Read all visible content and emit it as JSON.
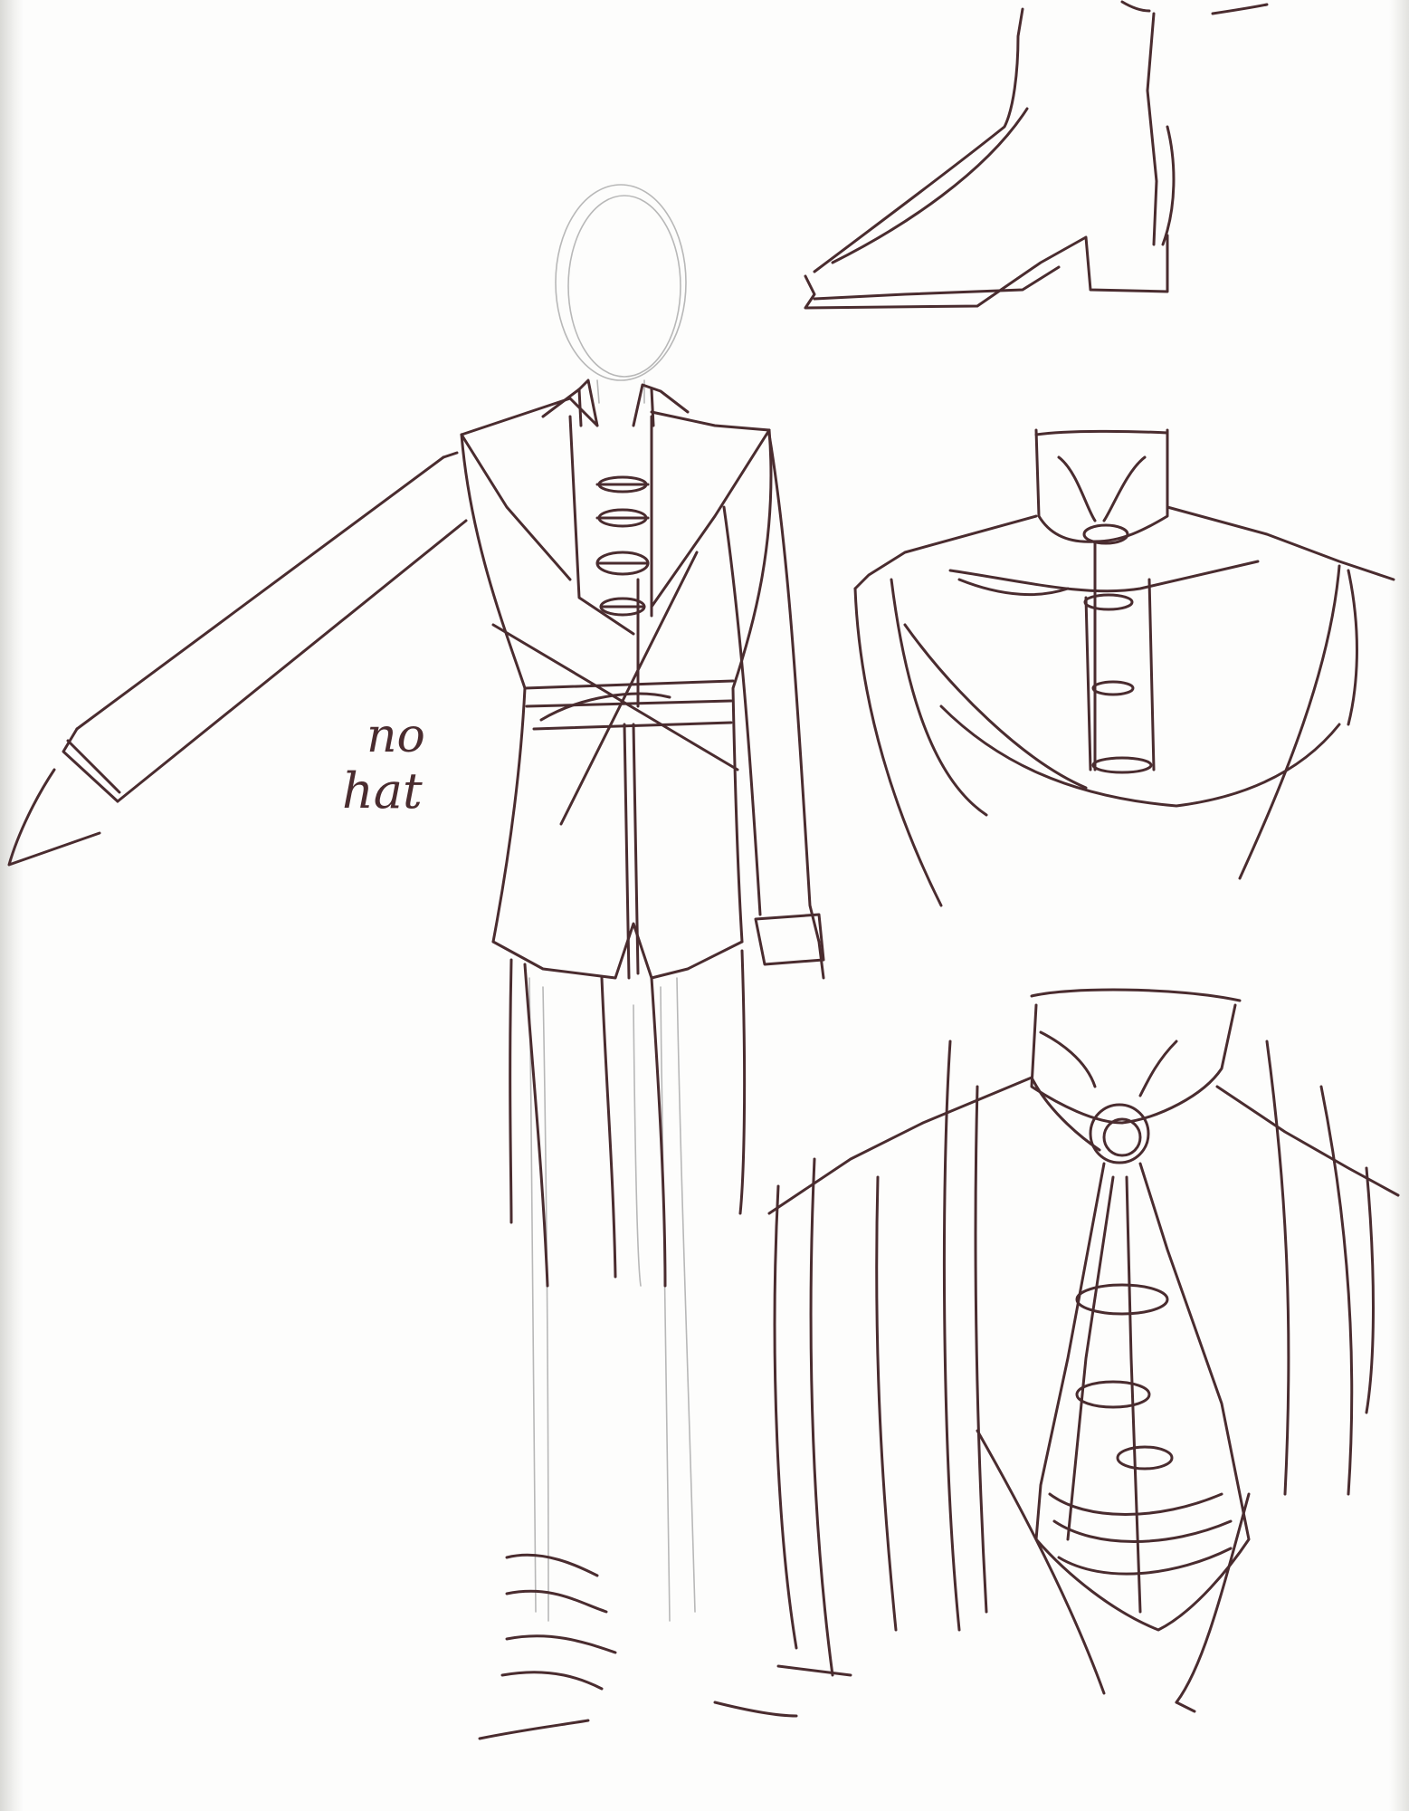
{
  "sketch": {
    "note_line_1": "no",
    "note_line_2": "hat",
    "ink_color": "#4a2c2f",
    "pencil_color": "#b8b8b8",
    "paper_color": "#fdfdfc"
  }
}
